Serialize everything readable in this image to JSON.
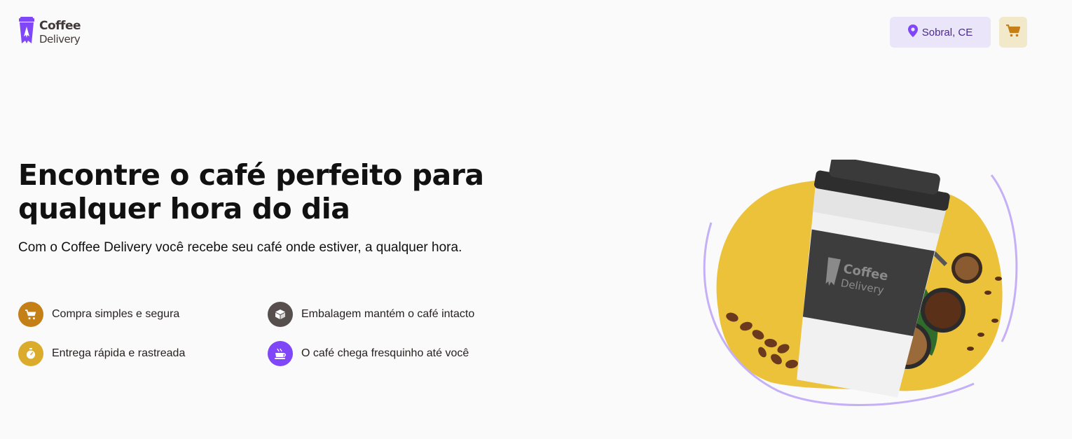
{
  "header": {
    "logo": {
      "line1": "Coffee",
      "line2": "Delivery"
    },
    "location": {
      "label": "Sobral, CE",
      "icon": "map-pin-icon"
    },
    "cart": {
      "icon": "shopping-cart-icon"
    }
  },
  "hero": {
    "title": "Encontre o café perfeito para qualquer hora do dia",
    "subtitle": "Com o Coffee Delivery você recebe seu café onde estiver, a qualquer hora.",
    "features": [
      {
        "label": "Compra simples e segura",
        "icon": "shopping-cart-icon",
        "color": "#c47f17"
      },
      {
        "label": "Embalagem mantém o café intacto",
        "icon": "package-icon",
        "color": "#574f4d"
      },
      {
        "label": "Entrega rápida e rastreada",
        "icon": "timer-icon",
        "color": "#dbac2c"
      },
      {
        "label": "O café chega fresquinho até você",
        "icon": "coffee-cup-icon",
        "color": "#8047f8"
      }
    ],
    "image": {
      "cup_logo_line1": "Coffee",
      "cup_logo_line2": "Delivery"
    }
  },
  "colors": {
    "background": "#fafafa",
    "purple": "#8047f8",
    "purple_dark": "#4b2995",
    "purple_light": "#ebe5f9",
    "yellow": "#dbac2c",
    "yellow_dark": "#c47f17",
    "yellow_light": "#f1e9c9",
    "blob_yellow": "#ebc23a"
  }
}
